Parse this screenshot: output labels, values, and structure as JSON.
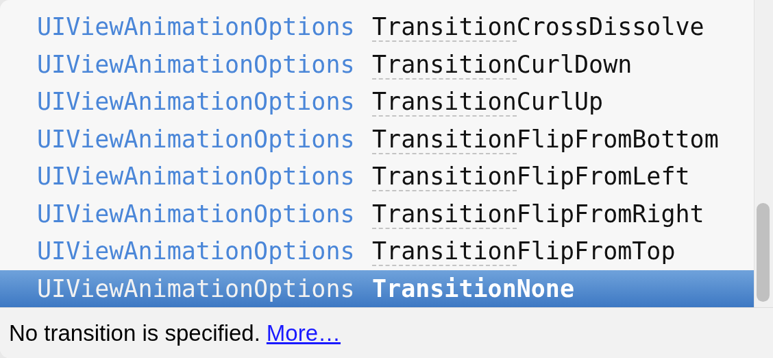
{
  "completions": [
    {
      "type": "UIViewAnimationOptions",
      "typed": "Transition",
      "rest": "CrossDissolve",
      "selected": false
    },
    {
      "type": "UIViewAnimationOptions",
      "typed": "Transition",
      "rest": "CurlDown",
      "selected": false
    },
    {
      "type": "UIViewAnimationOptions",
      "typed": "Transition",
      "rest": "CurlUp",
      "selected": false
    },
    {
      "type": "UIViewAnimationOptions",
      "typed": "Transition",
      "rest": "FlipFromBottom",
      "selected": false
    },
    {
      "type": "UIViewAnimationOptions",
      "typed": "Transition",
      "rest": "FlipFromLeft",
      "selected": false
    },
    {
      "type": "UIViewAnimationOptions",
      "typed": "Transition",
      "rest": "FlipFromRight",
      "selected": false
    },
    {
      "type": "UIViewAnimationOptions",
      "typed": "Transition",
      "rest": "FlipFromTop",
      "selected": false
    },
    {
      "type": "UIViewAnimationOptions",
      "typed": "Transition",
      "rest": "None",
      "selected": true
    }
  ],
  "description": {
    "text": "No transition is specified.",
    "link": "More…"
  }
}
